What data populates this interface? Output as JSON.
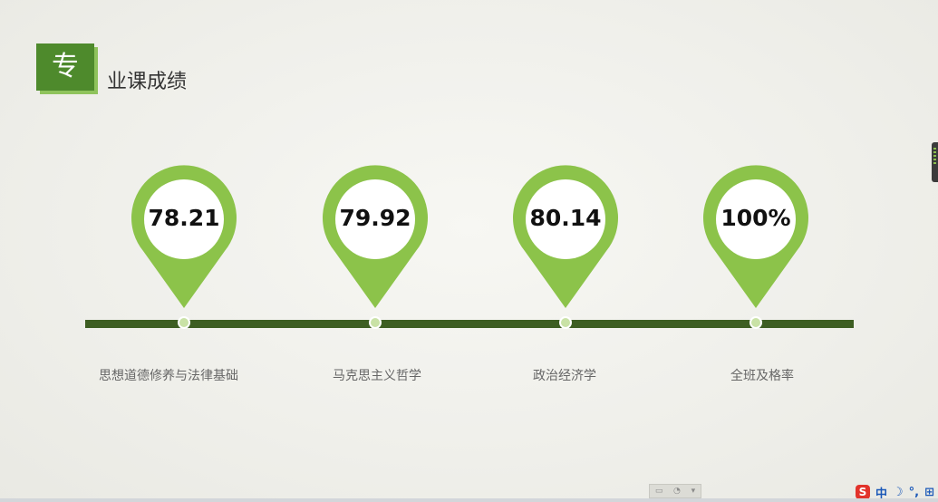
{
  "header": {
    "badge_char": "专",
    "title_rest": "业课成绩"
  },
  "colors": {
    "pin_green": "#8cc34a",
    "pin_inner": "#ffffff",
    "timeline": "#3d5e22",
    "badge": "#4e8a2c"
  },
  "stats": [
    {
      "value": "78.21",
      "label": "思想道德修养与法律基础"
    },
    {
      "value": "79.92",
      "label": "马克思主义哲学"
    },
    {
      "value": "80.14",
      "label": "政治经济学"
    },
    {
      "value": "100%",
      "label": "全班及格率"
    }
  ],
  "toolbar": {
    "icons": [
      "small-icon-1",
      "small-icon-2",
      "small-icon-3"
    ]
  },
  "ime": {
    "logo": "S",
    "mode": "中",
    "moon": "☽",
    "punct": "°,",
    "kbd": "⊞"
  }
}
